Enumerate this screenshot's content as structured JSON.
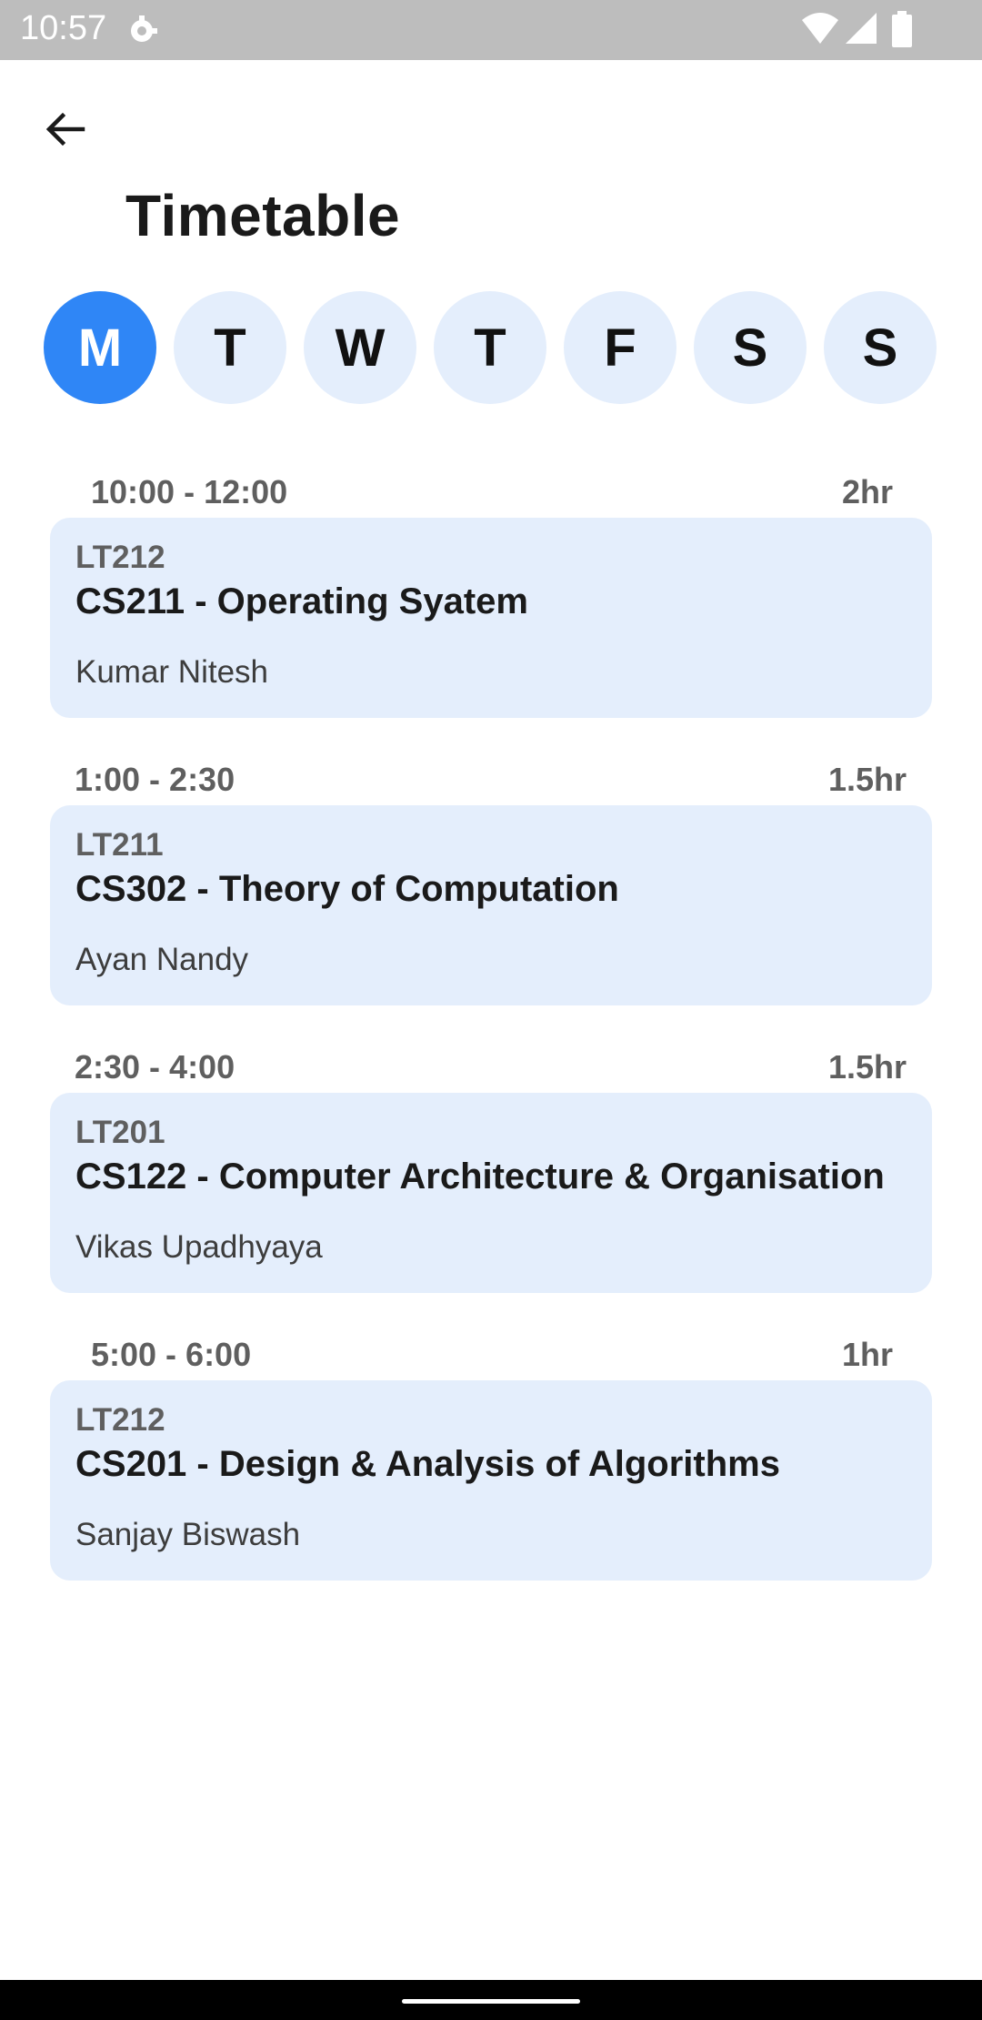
{
  "status_bar": {
    "time": "10:57",
    "icons": [
      "gear-icon",
      "wifi-icon",
      "signal-icon",
      "battery-icon"
    ]
  },
  "app_bar": {
    "back_icon": "arrow-left-icon",
    "title": "Timetable"
  },
  "days": [
    {
      "label": "M",
      "active": true
    },
    {
      "label": "T",
      "active": false
    },
    {
      "label": "W",
      "active": false
    },
    {
      "label": "T",
      "active": false
    },
    {
      "label": "F",
      "active": false
    },
    {
      "label": "S",
      "active": false
    },
    {
      "label": "S",
      "active": false
    }
  ],
  "classes": [
    {
      "time": "10:00 - 12:00",
      "duration": "2hr",
      "room": "LT212",
      "course": "CS211 - Operating Syatem",
      "faculty": "Kumar Nitesh"
    },
    {
      "time": "1:00 - 2:30",
      "duration": "1.5hr",
      "room": "LT211",
      "course": "CS302 - Theory of Computation",
      "faculty": "Ayan Nandy"
    },
    {
      "time": "2:30 - 4:00",
      "duration": "1.5hr",
      "room": "LT201",
      "course": "CS122 - Computer Architecture & Organisation",
      "faculty": "Vikas Upadhyaya"
    },
    {
      "time": "5:00 - 6:00",
      "duration": "1hr",
      "room": "LT212",
      "course": "CS201 - Design & Analysis of Algorithms",
      "faculty": "Sanjay Biswash"
    }
  ],
  "colors": {
    "active_day": "#2f86f6",
    "chip_background": "#e4eefc",
    "card_background": "#e4eefc",
    "status_bar": "#bdbdbd"
  }
}
